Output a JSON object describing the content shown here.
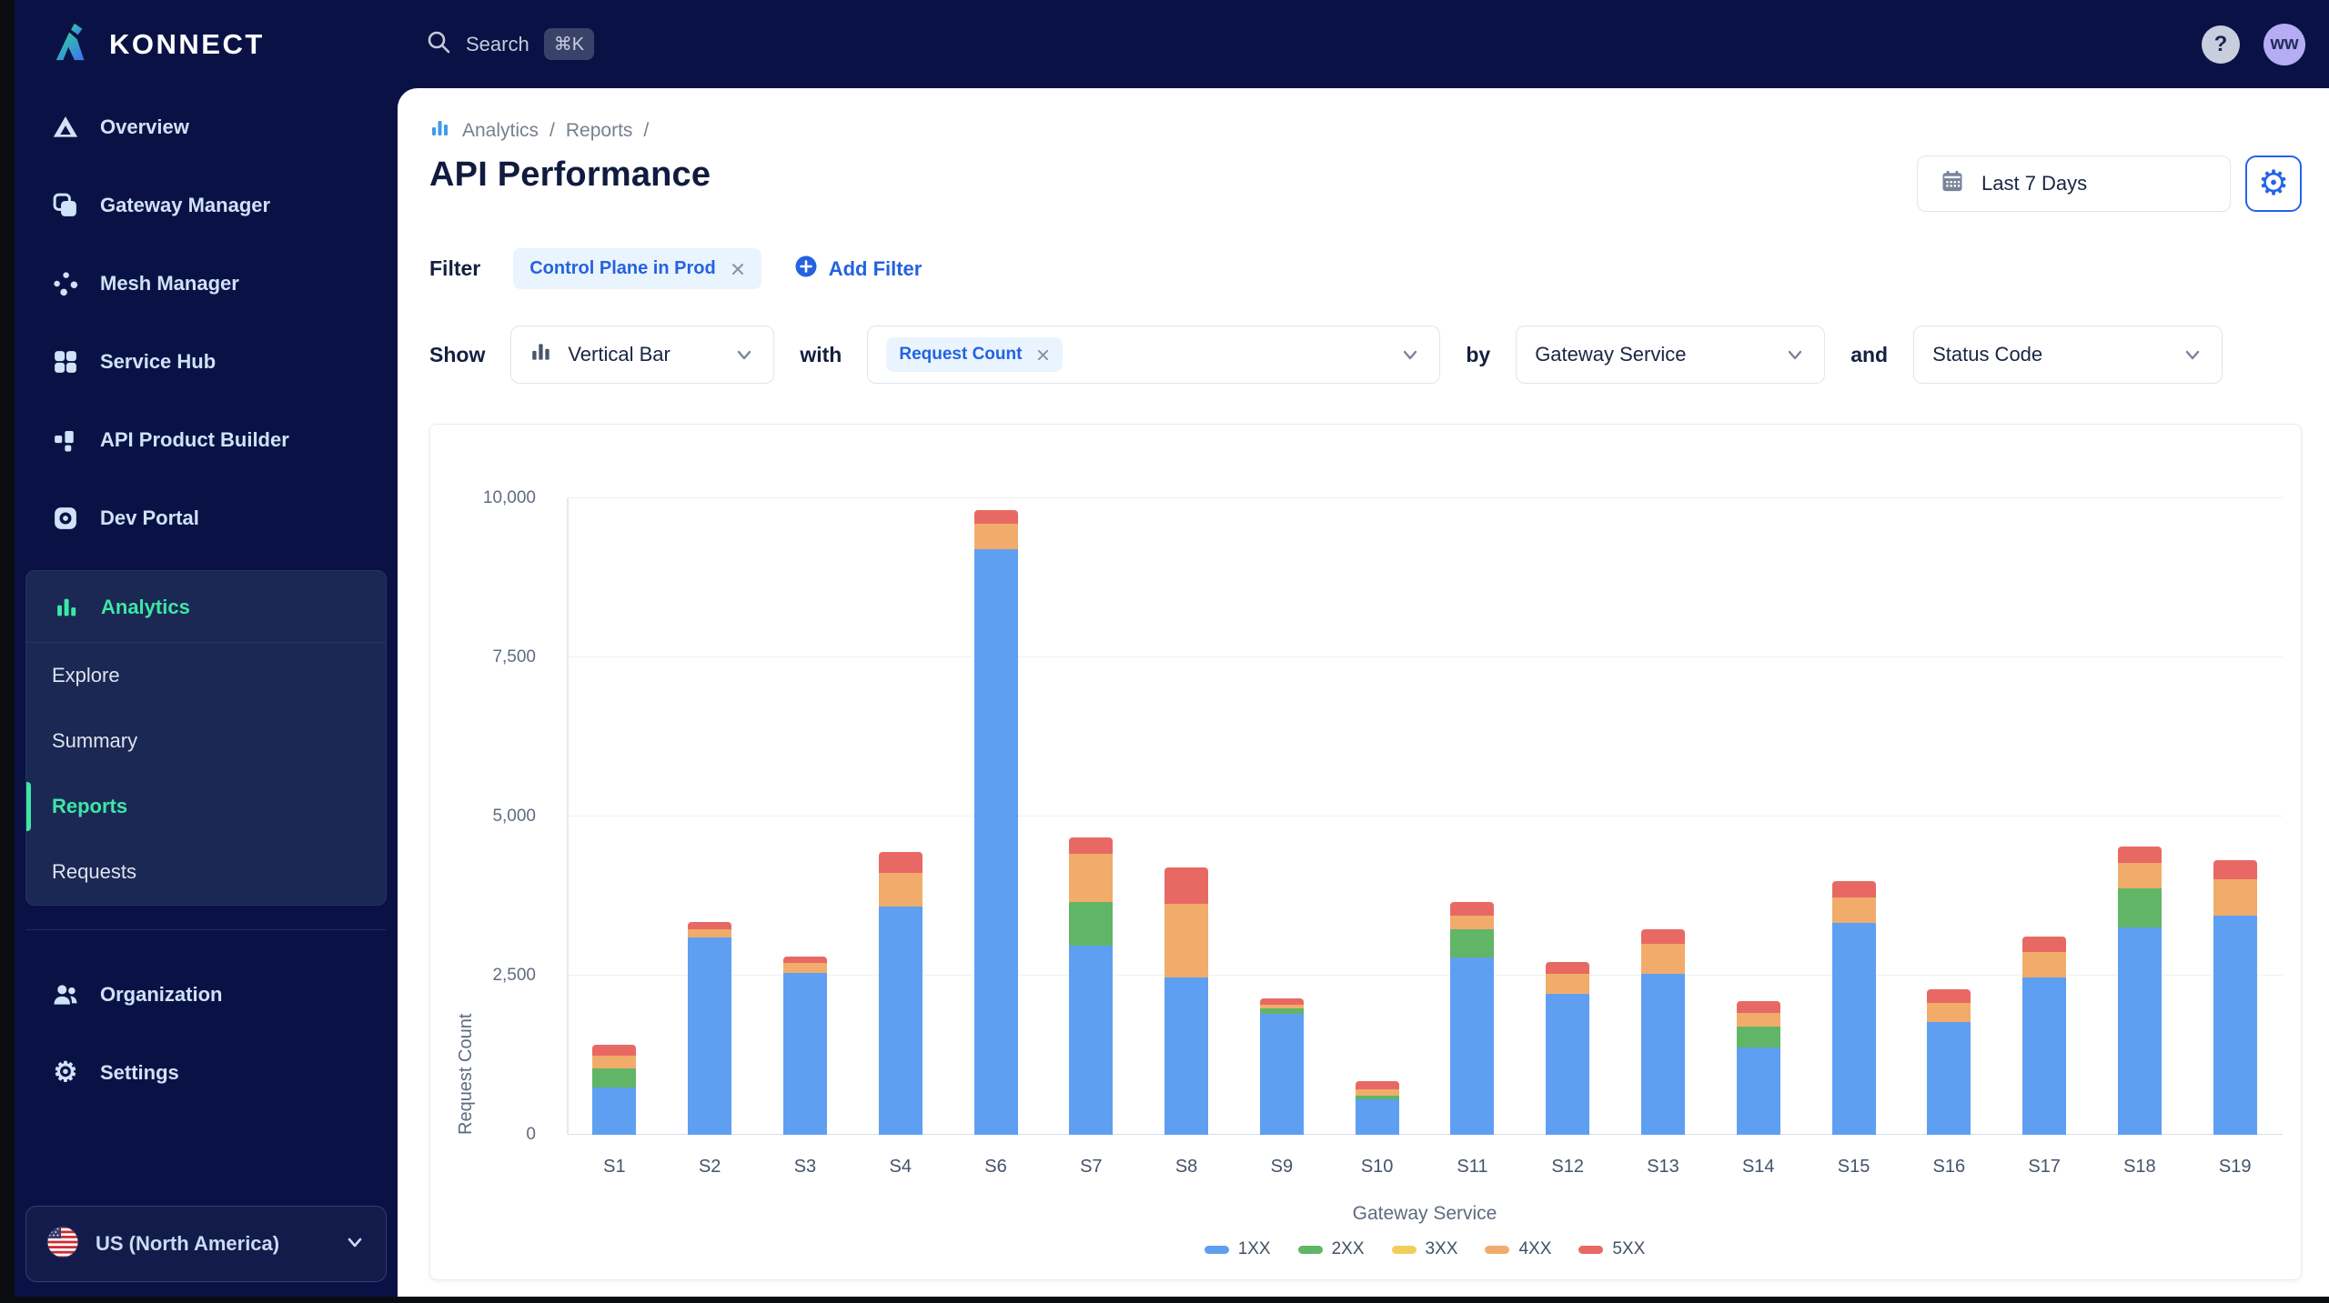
{
  "colors": {
    "navy_bg": "#0A1245",
    "panel_navy": "#1B2853",
    "teal_accent": "#3EE6A6",
    "blue_accent": "#2462E0",
    "chip_bg": "#EAF4FF",
    "avatar_bg": "#B5ACF4"
  },
  "icons": {
    "gear": "⚙"
  },
  "topbar": {
    "brand": "KONNECT",
    "search_label": "Search",
    "search_shortcut": "⌘K",
    "help_label": "?",
    "avatar_initials": "ww"
  },
  "sidebar": {
    "items": [
      {
        "icon": "overview-icon",
        "label": "Overview"
      },
      {
        "icon": "gateway-manager-icon",
        "label": "Gateway Manager"
      },
      {
        "icon": "mesh-manager-icon",
        "label": "Mesh Manager"
      },
      {
        "icon": "service-hub-icon",
        "label": "Service Hub"
      },
      {
        "icon": "api-product-builder-icon",
        "label": "API Product Builder"
      },
      {
        "icon": "dev-portal-icon",
        "label": "Dev Portal"
      }
    ],
    "analytics": {
      "label": "Analytics",
      "children": [
        "Explore",
        "Summary",
        "Reports",
        "Requests"
      ],
      "active_child": "Reports"
    },
    "organization_label": "Organization",
    "settings_label": "Settings",
    "region": {
      "label": "US (North America)"
    }
  },
  "main": {
    "breadcrumb": {
      "items": [
        "Analytics",
        "Reports"
      ],
      "separator": "/"
    },
    "title": "API Performance",
    "controls": {
      "date_range": "Last 7 Days"
    },
    "filter": {
      "label": "Filter",
      "chip": "Control Plane in Prod",
      "add_label": "Add Filter"
    },
    "show": {
      "label": "Show",
      "chart_type": "Vertical Bar",
      "with_label": "with",
      "metric": "Request Count",
      "by_label": "by",
      "group_by": "Gateway Service",
      "and_label": "and",
      "then_by": "Status Code"
    }
  },
  "chart_data": {
    "type": "bar",
    "stacked": true,
    "title": "",
    "xlabel": "Gateway Service",
    "ylabel": "Request Count",
    "ylim": [
      0,
      10000
    ],
    "yticks": [
      0,
      2500,
      5000,
      7500,
      10000
    ],
    "ytick_labels": [
      "0",
      "2,500",
      "5,000",
      "7,500",
      "10,000"
    ],
    "grid": true,
    "legend_position": "bottom",
    "categories": [
      "S1",
      "S2",
      "S3",
      "S4",
      "S6",
      "S7",
      "S8",
      "S9",
      "S10",
      "S11",
      "S12",
      "S13",
      "S14",
      "S15",
      "S16",
      "S17",
      "S18",
      "S19"
    ],
    "series": [
      {
        "name": "1XX",
        "color": "#5F9FF2",
        "values": [
          750,
          3100,
          2550,
          3590,
          9200,
          2970,
          2465,
          1900,
          560,
          2790,
          2210,
          2535,
          1375,
          3335,
          1775,
          2465,
          3260,
          3440
        ]
      },
      {
        "name": "2XX",
        "color": "#61B566",
        "values": [
          300,
          0,
          0,
          0,
          0,
          690,
          0,
          80,
          50,
          435,
          0,
          0,
          325,
          0,
          0,
          0,
          615,
          0
        ]
      },
      {
        "name": "3XX",
        "color": "#F1CD5C",
        "values": [
          0,
          0,
          0,
          0,
          0,
          0,
          0,
          0,
          0,
          0,
          0,
          0,
          0,
          0,
          0,
          0,
          0,
          0
        ]
      },
      {
        "name": "4XX",
        "color": "#F1AC6B",
        "values": [
          200,
          130,
          145,
          530,
          400,
          760,
          1160,
          60,
          110,
          220,
          325,
          470,
          220,
          400,
          290,
          400,
          400,
          580
        ]
      },
      {
        "name": "5XX",
        "color": "#E86964",
        "values": [
          160,
          110,
          100,
          320,
          220,
          255,
          580,
          100,
          130,
          215,
          180,
          220,
          180,
          250,
          215,
          255,
          255,
          290
        ]
      }
    ]
  }
}
